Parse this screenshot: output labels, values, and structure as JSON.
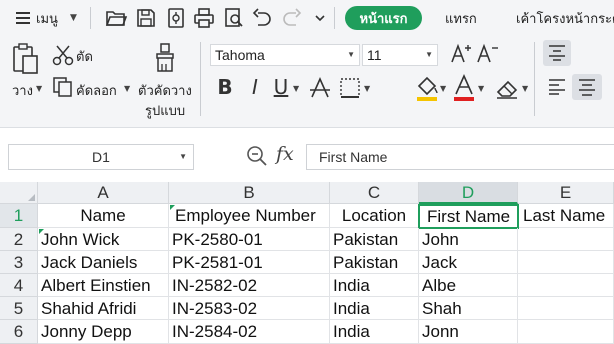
{
  "menubar": {
    "menu_label": "เมนู",
    "tabs": [
      "หน้าแรก",
      "แทรก",
      "เค้าโครงหน้ากระดาษ"
    ],
    "icons": [
      "hamburger-icon",
      "open-folder-icon",
      "save-icon",
      "export-icon",
      "print-icon",
      "print-preview-icon",
      "undo-icon",
      "redo-icon",
      "more-chevron-icon"
    ]
  },
  "ribbon": {
    "paste_label": "วาง",
    "cut_label": "ตัด",
    "copy_label": "คัดลอก",
    "format_painter_label_1": "ตัวคัดวาง",
    "format_painter_label_2": "รูปแบบ",
    "font_name": "Tahoma",
    "font_size": "11",
    "accent_colors": {
      "font_color": "#e02020",
      "fill_color": "#f5c400",
      "brand": "#1f9e5c"
    }
  },
  "formula_bar": {
    "name_box": "D1",
    "fx": "fx",
    "content": "First Name"
  },
  "grid": {
    "columns": [
      "A",
      "B",
      "C",
      "D",
      "E"
    ],
    "active_column": "D",
    "rows": [
      {
        "num": "1",
        "cells": [
          "Name",
          "Employee Number",
          "Location",
          "First Name",
          "Last Name"
        ]
      },
      {
        "num": "2",
        "cells": [
          "John Wick",
          "PK-2580-01",
          "Pakistan",
          "John",
          ""
        ]
      },
      {
        "num": "3",
        "cells": [
          "Jack Daniels",
          "PK-2581-01",
          "Pakistan",
          "Jack",
          ""
        ]
      },
      {
        "num": "4",
        "cells": [
          "Albert Einstien",
          "IN-2582-02",
          "India",
          "Albe",
          ""
        ]
      },
      {
        "num": "5",
        "cells": [
          "Shahid Afridi",
          "IN-2583-02",
          "India",
          "Shah",
          ""
        ]
      },
      {
        "num": "6",
        "cells": [
          "Jonny Depp",
          "IN-2584-02",
          "India",
          "Jonn",
          ""
        ]
      }
    ],
    "selected_cell": "D1"
  }
}
